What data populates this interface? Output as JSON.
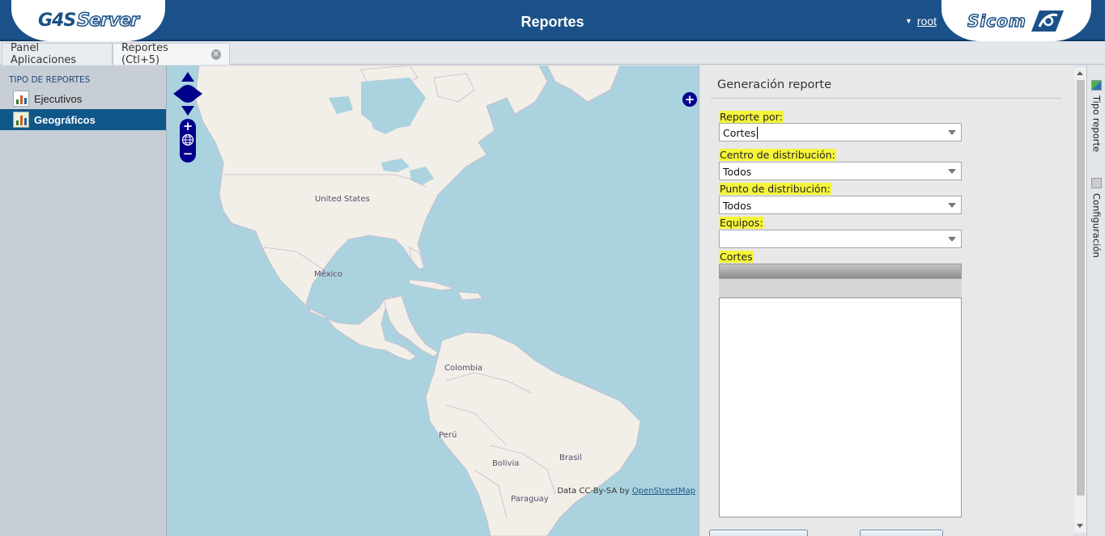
{
  "header": {
    "logo_left": "G4S",
    "logo_left_suffix": "Server",
    "title": "Reportes",
    "user": "root",
    "logo_right": "Sicom",
    "accent_color": "#1b5188"
  },
  "tabs": [
    {
      "label": "Panel Aplicaciones",
      "active": false
    },
    {
      "label": "Reportes (Ctl+5)",
      "active": true
    }
  ],
  "sidebar": {
    "section": "TIPO DE REPORTES",
    "items": [
      {
        "label": "Ejecutivos",
        "icon": "bar-chart-icon",
        "selected": false
      },
      {
        "label": "Geográficos",
        "icon": "map-chart-icon",
        "selected": true
      }
    ]
  },
  "map": {
    "labels": [
      "United States",
      "México",
      "Colombia",
      "Perú",
      "Bolivia",
      "Brasil",
      "Paraguay"
    ],
    "attribution_prefix": "Data CC-By-SA by ",
    "attribution_link": "OpenStreetMap",
    "controls": [
      "pan-up-icon",
      "pan-left-icon",
      "pan-right-icon",
      "pan-down-icon",
      "zoom-in-icon",
      "world-icon",
      "zoom-out-icon",
      "expand-panel-icon"
    ]
  },
  "panel": {
    "title": "Generación reporte",
    "fields": [
      {
        "label": "Reporte por:",
        "value": "Cortes"
      },
      {
        "label": "Centro de distribución:",
        "value": "Todos"
      },
      {
        "label": "Punto de distribución:",
        "value": "Todos"
      },
      {
        "label": "Equipos:",
        "value": ""
      }
    ],
    "grid_label": "Cortes"
  },
  "right_bar": {
    "tabs": [
      "Tipo reporte",
      "Configuración"
    ]
  }
}
